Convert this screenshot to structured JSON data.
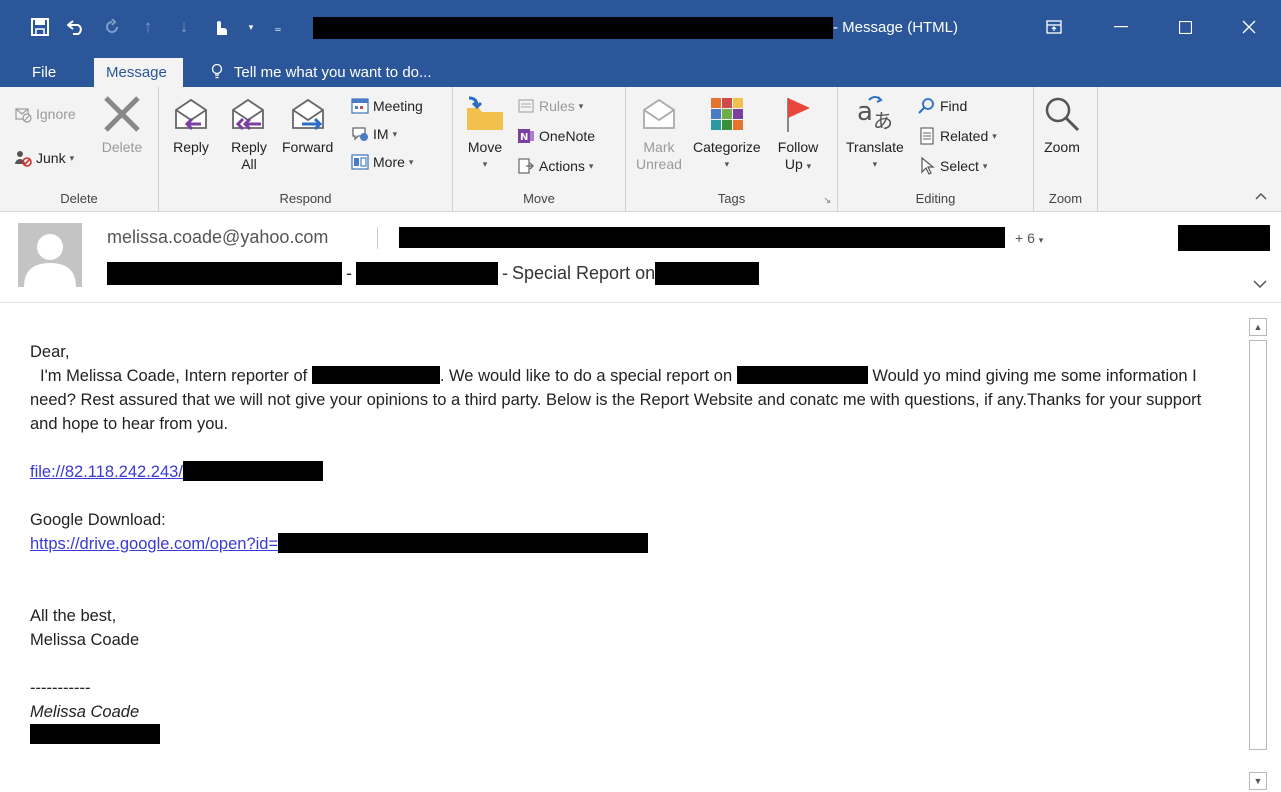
{
  "window": {
    "title_suffix": "- Message (HTML)",
    "restore_icon": "ribbon-display-icon",
    "minimize_glyph": "—",
    "maximize_glyph": "☐",
    "close_glyph": "✕"
  },
  "qat": {
    "icons": [
      "save-icon",
      "undo-icon",
      "redo-icon",
      "up-icon",
      "down-icon",
      "touch-mode-icon",
      "customize-icon"
    ]
  },
  "tabs": [
    {
      "label": "File"
    },
    {
      "label": "Message"
    }
  ],
  "tellme": {
    "label": "Tell me what you want to do..."
  },
  "ribbon": {
    "delete": {
      "ignore": "Ignore",
      "junk": "Junk",
      "delete": "Delete",
      "group": "Delete"
    },
    "respond": {
      "reply": "Reply",
      "reply_all_1": "Reply",
      "reply_all_2": "All",
      "forward": "Forward",
      "meeting": "Meeting",
      "im": "IM",
      "more": "More",
      "group": "Respond"
    },
    "move": {
      "move": "Move",
      "rules": "Rules",
      "onenote": "OneNote",
      "actions": "Actions",
      "group": "Move"
    },
    "tags": {
      "mark_1": "Mark",
      "mark_2": "Unread",
      "categorize": "Categorize",
      "follow_1": "Follow",
      "follow_2": "Up",
      "group": "Tags"
    },
    "editing": {
      "translate": "Translate",
      "find": "Find",
      "related": "Related",
      "select": "Select",
      "group": "Editing"
    },
    "zoom": {
      "zoom": "Zoom",
      "group": "Zoom"
    }
  },
  "header": {
    "sender": "melissa.coade@yahoo.com",
    "more_recipients": "+ 6",
    "subject_sep": "-",
    "subject_sep2": "-",
    "subject_text": "Special Report on"
  },
  "body": {
    "greeting": "Dear,",
    "p1_a": "I'm Melissa Coade, Intern reporter of",
    "p1_b": ". We would like to do a special report on",
    "p1_c": "Would yo mind giving me some information I need? Rest assured that we will not give your opinions to a third party. Below is the Report Website and conatc me with questions, if any.Thanks for your support and hope to hear from you.",
    "link1": "file://82.118.242.243/",
    "gd_label": "Google Download:",
    "link2": "https://drive.google.com/open?id=",
    "closing": "All the best,",
    "sig_name": "Melissa Coade",
    "dashes": "-----------",
    "sig_italic": "Melissa Coade"
  },
  "colors": {
    "titlebar": "#2b579a",
    "ribbon_bg": "#f3f3f3",
    "link": "#3a3ad6"
  }
}
